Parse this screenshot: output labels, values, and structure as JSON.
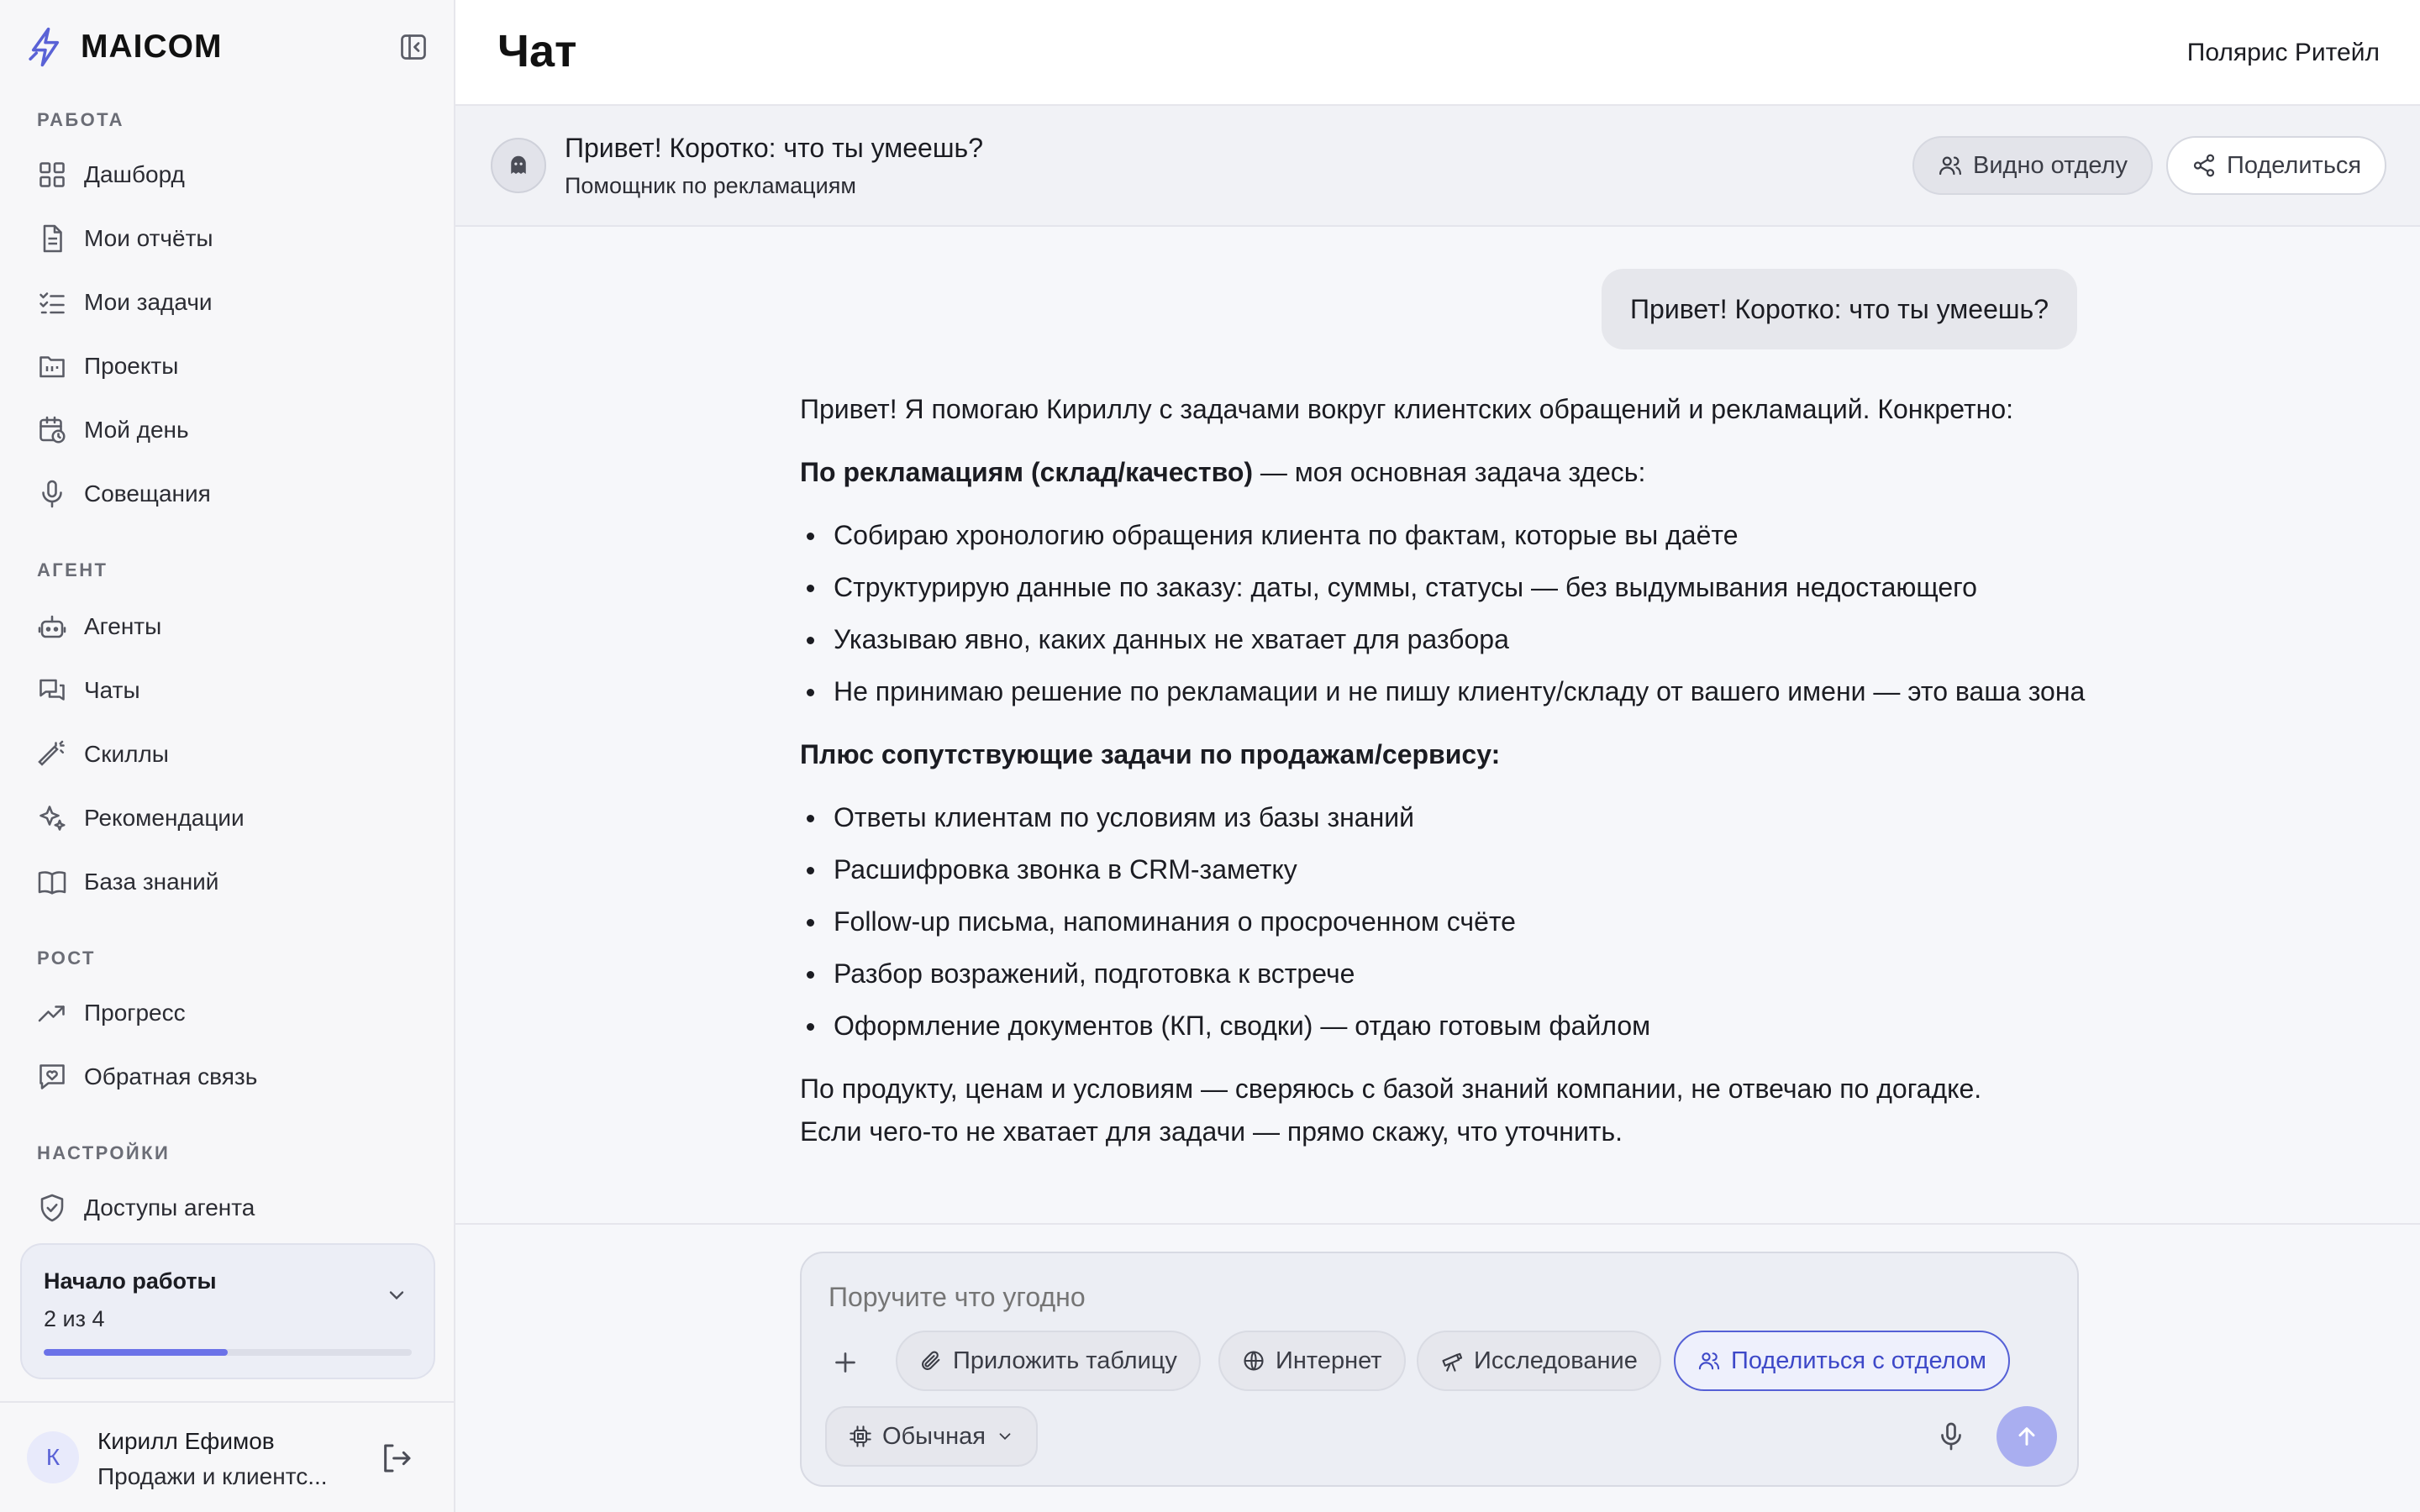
{
  "app": {
    "brand": "MAICOM",
    "accent": "#5560d6"
  },
  "sidebar": {
    "sections": [
      {
        "title": "РАБОТА",
        "items": [
          {
            "label": "Дашборд",
            "icon": "grid-icon"
          },
          {
            "label": "Мои отчёты",
            "icon": "document-icon"
          },
          {
            "label": "Мои задачи",
            "icon": "checklist-icon"
          },
          {
            "label": "Проекты",
            "icon": "folder-icon"
          },
          {
            "label": "Мой день",
            "icon": "calendar-clock-icon"
          },
          {
            "label": "Совещания",
            "icon": "microphone-icon"
          }
        ]
      },
      {
        "title": "АГЕНТ",
        "items": [
          {
            "label": "Агенты",
            "icon": "robot-icon"
          },
          {
            "label": "Чаты",
            "icon": "chat-bubbles-icon"
          },
          {
            "label": "Скиллы",
            "icon": "magic-wand-icon"
          },
          {
            "label": "Рекомендации",
            "icon": "sparkles-icon"
          },
          {
            "label": "База знаний",
            "icon": "book-icon"
          }
        ]
      },
      {
        "title": "РОСТ",
        "items": [
          {
            "label": "Прогресс",
            "icon": "trending-up-icon"
          },
          {
            "label": "Обратная связь",
            "icon": "feedback-heart-icon"
          }
        ]
      },
      {
        "title": "НАСТРОЙКИ",
        "items": [
          {
            "label": "Доступы агента",
            "icon": "shield-check-icon"
          }
        ]
      }
    ],
    "onboarding": {
      "title": "Начало работы",
      "progress_text": "2 из 4",
      "progress": 0.5
    },
    "user": {
      "initial": "К",
      "name": "Кирилл Ефимов",
      "role": "Продажи и клиентс..."
    }
  },
  "header": {
    "title": "Чат",
    "org": "Полярис Ритейл"
  },
  "chat": {
    "title": "Привет! Коротко: что ты умеешь?",
    "agent": "Помощник по рекламациям",
    "visibility_label": "Видно отделу",
    "share_label": "Поделиться",
    "user_message": "Привет! Коротко: что ты умеешь?",
    "answer": {
      "intro": "Привет! Я помогаю Кириллу с задачами вокруг клиентских обращений и рекламаций. Конкретно:",
      "s1_bold": "По рекламациям (склад/качество)",
      "s1_rest": " — моя основная задача здесь:",
      "s1_items": [
        "Собираю хронологию обращения клиента по фактам, которые вы даёте",
        "Структурирую данные по заказу: даты, суммы, статусы — без выдумывания недостающего",
        "Указываю явно, каких данных не хватает для разбора",
        "Не принимаю решение по рекламации и не пишу клиенту/складу от вашего имени — это ваша зона"
      ],
      "s2_bold": "Плюс сопутствующие задачи по продажам/сервису:",
      "s2_items": [
        "Ответы клиентам по условиям из базы знаний",
        "Расшифровка звонка в CRM-заметку",
        "Follow-up письма, напоминания о просроченном счёте",
        "Разбор возражений, подготовка к встрече",
        "Оформление документов (КП, сводки) — отдаю готовым файлом"
      ],
      "outro_1": "По продукту, ценам и условиям — сверяюсь с базой знаний компании, не отвечаю по догадке.",
      "outro_2": "Если чего-то не хватает для задачи — прямо скажу, что уточнить."
    }
  },
  "composer": {
    "placeholder": "Поручите что угодно",
    "chips": [
      "Приложить таблицу",
      "Интернет",
      "Исследование",
      "Поделиться с отделом"
    ],
    "mode": "Обычная"
  }
}
